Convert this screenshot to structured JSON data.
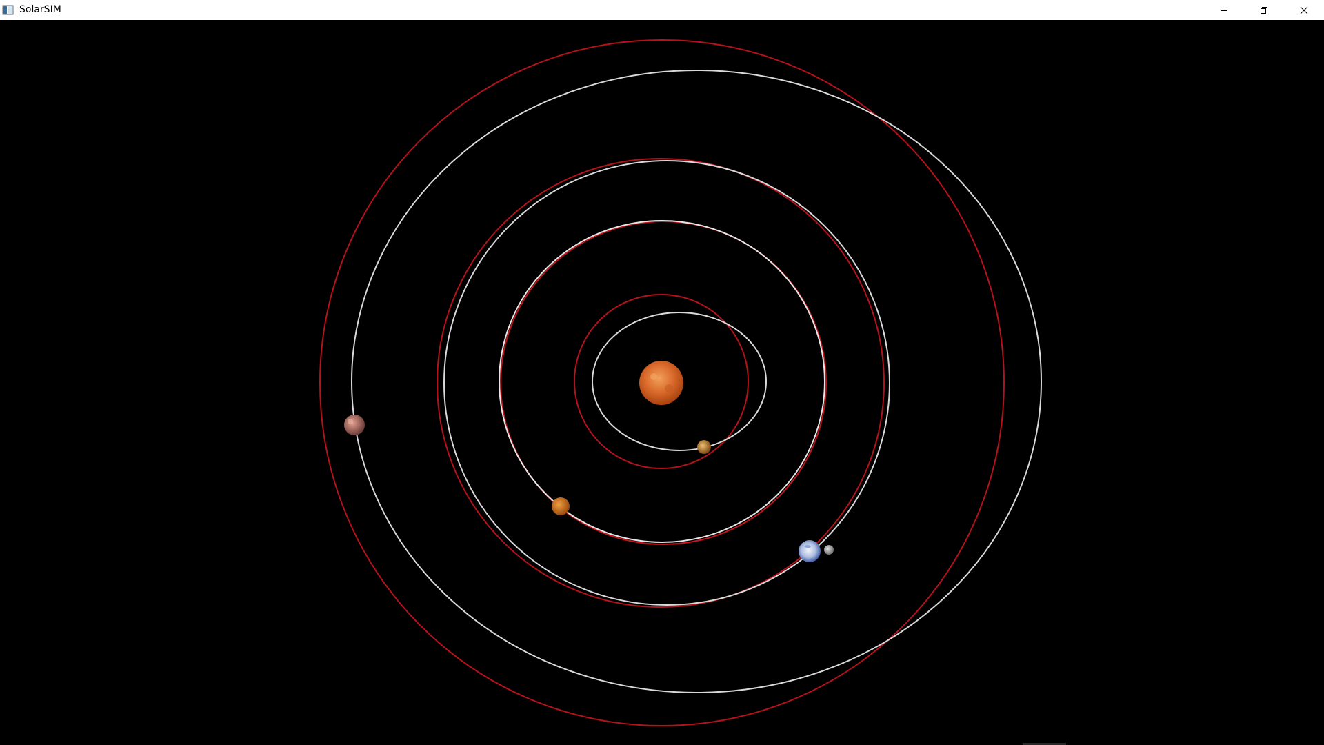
{
  "window": {
    "title": "SolarSIM",
    "app_icon": "app-window-icon",
    "controls": {
      "minimize_icon": "minimize-icon",
      "restore_icon": "restore-icon",
      "close_icon": "close-icon"
    }
  },
  "scene": {
    "background": "#000000",
    "orbit_colors": {
      "red": "#b5121b",
      "white": "#d9d9d9"
    },
    "bodies": [
      {
        "name": "sun",
        "color_core": "#e0782a",
        "color_edge": "#b34a12"
      },
      {
        "name": "inner-planet",
        "color_core": "#d9a04a",
        "color_edge": "#8a5a1e"
      },
      {
        "name": "orange-planet",
        "color_core": "#e08a2a",
        "color_edge": "#a14e10"
      },
      {
        "name": "earth",
        "color_core": "#e8eef8",
        "color_edge": "#3552a8"
      },
      {
        "name": "moon",
        "color_core": "#c8c8c8",
        "color_edge": "#7a7a7a"
      },
      {
        "name": "outer-planet",
        "color_core": "#c98070",
        "color_edge": "#7a4a44"
      }
    ]
  }
}
